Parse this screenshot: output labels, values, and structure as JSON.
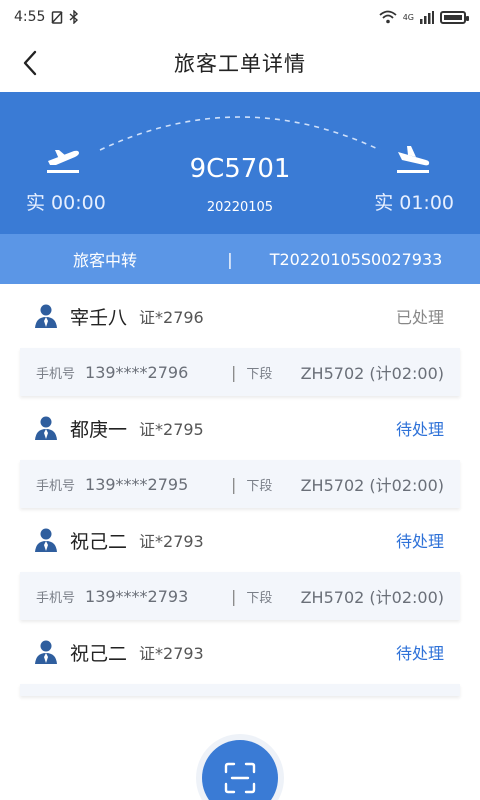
{
  "status_bar": {
    "time": "4:55",
    "network": "4G"
  },
  "header": {
    "title": "旅客工单详情"
  },
  "flight": {
    "number": "9C5701",
    "date": "20220105",
    "departure_time": "实 00:00",
    "arrival_time": "实 01:00"
  },
  "order": {
    "type": "旅客中转",
    "separator": "|",
    "number": "T20220105S0027933"
  },
  "passengers": [
    {
      "name": "宰壬八",
      "cert": "证*2796",
      "status": "已处理",
      "phone_label": "手机号",
      "phone": "139****2796",
      "segment_label": "下段",
      "next_flight": "ZH5702 (计02:00)"
    },
    {
      "name": "都庚一",
      "cert": "证*2795",
      "status": "待处理",
      "phone_label": "手机号",
      "phone": "139****2795",
      "segment_label": "下段",
      "next_flight": "ZH5702 (计02:00)"
    },
    {
      "name": "祝己二",
      "cert": "证*2793",
      "status": "待处理",
      "phone_label": "手机号",
      "phone": "139****2793",
      "segment_label": "下段",
      "next_flight": "ZH5702 (计02:00)"
    },
    {
      "name": "祝己二",
      "cert": "证*2793",
      "status": "待处理"
    }
  ],
  "colors": {
    "primary": "#3a7bd5",
    "order_bar": "#5b96e6",
    "pending": "#2f72d8",
    "done": "#888888"
  },
  "icons": {
    "back": "chevron-left-icon",
    "takeoff": "plane-takeoff-icon",
    "landing": "plane-landing-icon",
    "person": "person-icon",
    "scan": "scan-icon"
  }
}
